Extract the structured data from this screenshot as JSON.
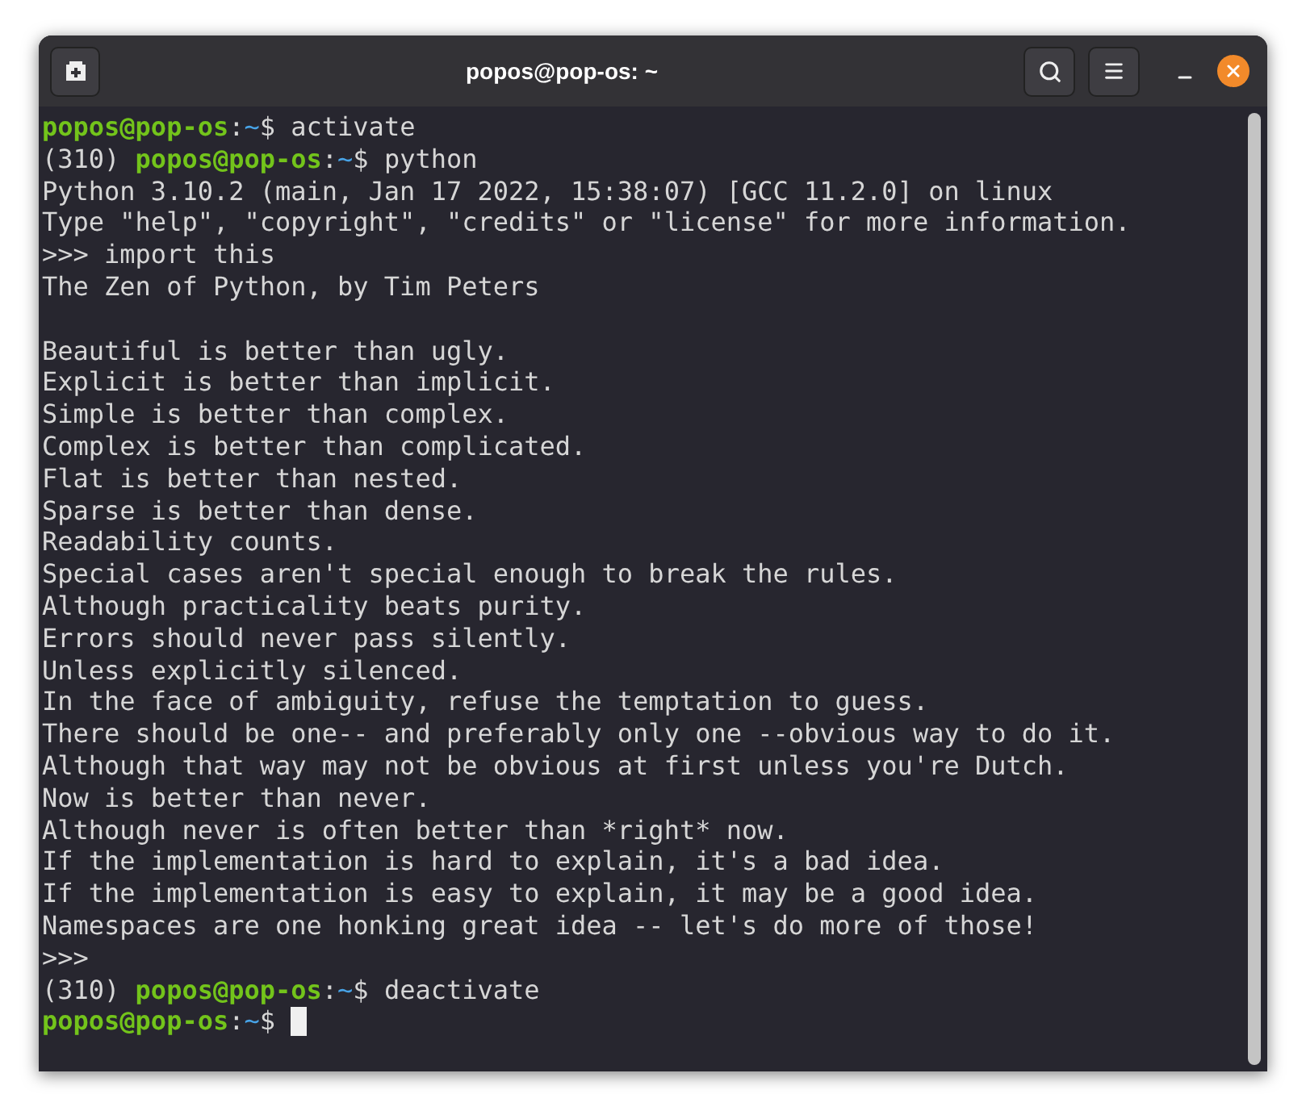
{
  "window": {
    "title": "popos@pop-os: ~"
  },
  "terminal": {
    "lines": [
      {
        "kind": "prompt",
        "user": "popos@pop-os",
        "sep": ":",
        "path": "~",
        "symbol": "$",
        "command": "activate",
        "cursor": false
      },
      {
        "kind": "prompt",
        "env": "(310)",
        "user": "popos@pop-os",
        "sep": ":",
        "path": "~",
        "symbol": "$",
        "command": "python",
        "cursor": false
      },
      {
        "kind": "output",
        "text": "Python 3.10.2 (main, Jan 17 2022, 15:38:07) [GCC 11.2.0] on linux"
      },
      {
        "kind": "output",
        "text": "Type \"help\", \"copyright\", \"credits\" or \"license\" for more information."
      },
      {
        "kind": "output",
        "text": ">>> import this"
      },
      {
        "kind": "output",
        "text": "The Zen of Python, by Tim Peters"
      },
      {
        "kind": "blank"
      },
      {
        "kind": "output",
        "text": "Beautiful is better than ugly."
      },
      {
        "kind": "output",
        "text": "Explicit is better than implicit."
      },
      {
        "kind": "output",
        "text": "Simple is better than complex."
      },
      {
        "kind": "output",
        "text": "Complex is better than complicated."
      },
      {
        "kind": "output",
        "text": "Flat is better than nested."
      },
      {
        "kind": "output",
        "text": "Sparse is better than dense."
      },
      {
        "kind": "output",
        "text": "Readability counts."
      },
      {
        "kind": "output",
        "text": "Special cases aren't special enough to break the rules."
      },
      {
        "kind": "output",
        "text": "Although practicality beats purity."
      },
      {
        "kind": "output",
        "text": "Errors should never pass silently."
      },
      {
        "kind": "output",
        "text": "Unless explicitly silenced."
      },
      {
        "kind": "output",
        "text": "In the face of ambiguity, refuse the temptation to guess."
      },
      {
        "kind": "output",
        "text": "There should be one-- and preferably only one --obvious way to do it."
      },
      {
        "kind": "output",
        "text": "Although that way may not be obvious at first unless you're Dutch."
      },
      {
        "kind": "output",
        "text": "Now is better than never."
      },
      {
        "kind": "output",
        "text": "Although never is often better than *right* now."
      },
      {
        "kind": "output",
        "text": "If the implementation is hard to explain, it's a bad idea."
      },
      {
        "kind": "output",
        "text": "If the implementation is easy to explain, it may be a good idea."
      },
      {
        "kind": "output",
        "text": "Namespaces are one honking great idea -- let's do more of those!"
      },
      {
        "kind": "output",
        "text": ">>>"
      },
      {
        "kind": "prompt",
        "env": "(310)",
        "user": "popos@pop-os",
        "sep": ":",
        "path": "~",
        "symbol": "$",
        "command": "deactivate",
        "cursor": false
      },
      {
        "kind": "prompt",
        "user": "popos@pop-os",
        "sep": ":",
        "path": "~",
        "symbol": "$",
        "cursor": true
      }
    ]
  }
}
